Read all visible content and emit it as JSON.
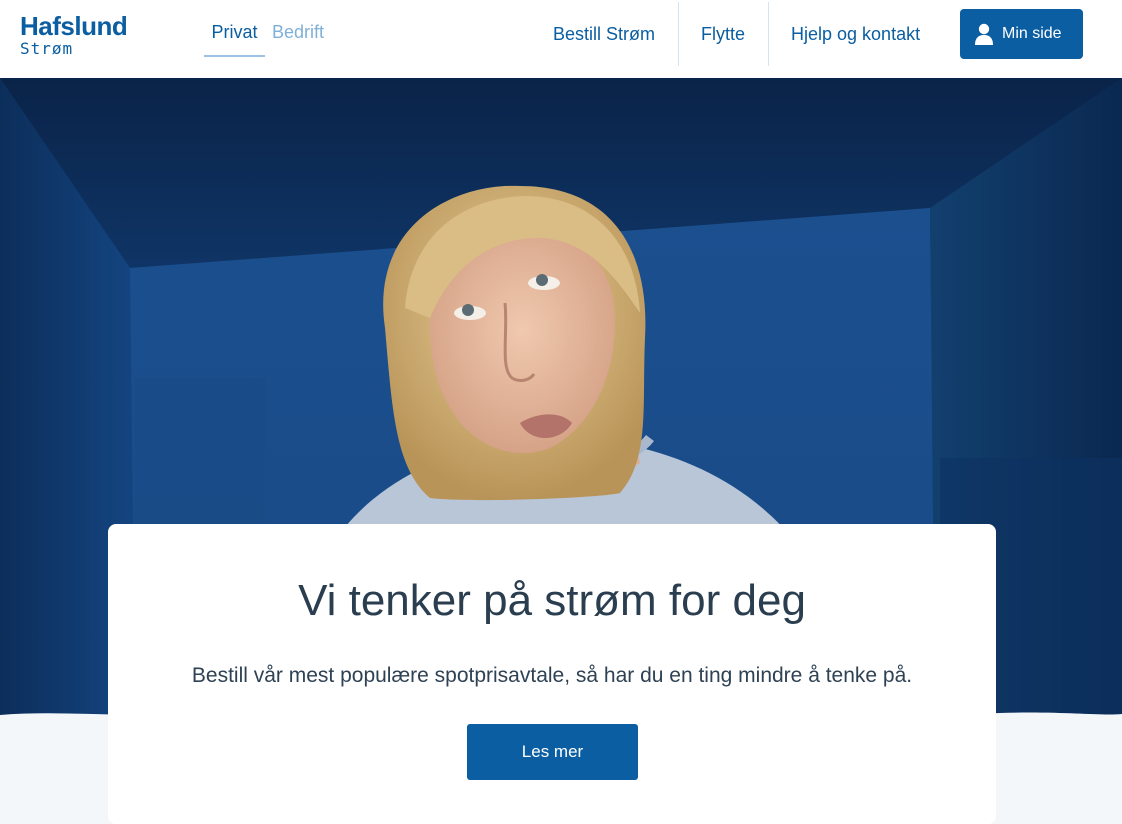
{
  "header": {
    "logo": {
      "name": "Hafslund",
      "sub": "Strøm"
    },
    "segments": [
      {
        "label": "Privat",
        "active": true
      },
      {
        "label": "Bedrift",
        "active": false
      }
    ],
    "nav": {
      "bestill": "Bestill Strøm",
      "flytte": "Flytte",
      "hjelp": "Hjelp og kontakt"
    },
    "account_button": {
      "label": "Min side",
      "icon": "user-icon"
    }
  },
  "hero": {
    "image": "woman-looking-up-blue-room",
    "colors": {
      "wall": "#123f74",
      "hair": "#d8b77a",
      "skin": "#e4b89c",
      "sweater": "#b8c6d8"
    }
  },
  "card": {
    "title": "Vi tenker på strøm for deg",
    "text": "Bestill vår mest populære spotprisavtale, så har du en ting mindre å tenke på.",
    "button": "Les mer"
  },
  "colors": {
    "brand": "#0a5ea1",
    "text": "#2a3e50",
    "page_bg": "#f4f7fa"
  }
}
